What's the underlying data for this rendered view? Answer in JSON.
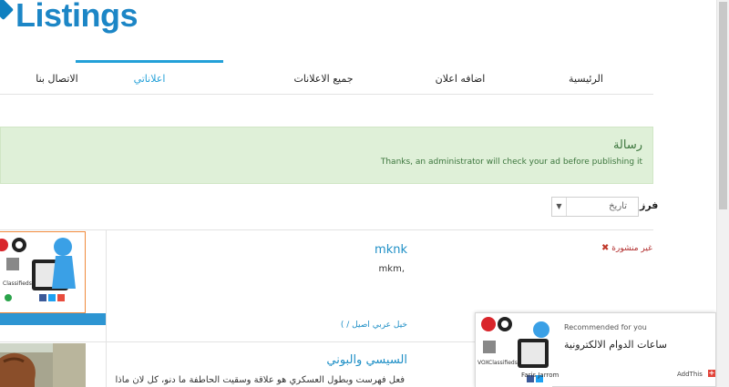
{
  "logo": {
    "text": "Listings"
  },
  "nav": {
    "items": [
      {
        "label": "الرئيسية"
      },
      {
        "label": "اضافه اعلان"
      },
      {
        "label": "جميع الاعلانات"
      },
      {
        "label": "اعلاناتي"
      },
      {
        "label": "الاتصال بنا"
      }
    ],
    "active_index": 3
  },
  "alert": {
    "title": "رسالة",
    "text": "Thanks, an administrator will check your ad before publishing it"
  },
  "sort": {
    "label": "فرز",
    "value": "تاريخ"
  },
  "listings": [
    {
      "title": "mknk",
      "description": "mkm,",
      "category": "( / خيل عربي اصيل",
      "status": "غير منشورة"
    },
    {
      "title": "السيسي والبوني",
      "description": "فعل فهرست وبطول العسكري هو علاقة وسقيت الحاطفة ما دنو، كل لان ماذا"
    }
  ],
  "ad": {
    "recommended": "Recommended for you",
    "title": "ساعات الدوام الالكترونية",
    "addthis": "AddThis",
    "caption": "Faris Jarrom"
  },
  "colors": {
    "brand": "#1c86c6",
    "accent": "#23a0d8",
    "alert_bg": "#dff0d8",
    "alert_text": "#3c763d",
    "status_red": "#b02a2a"
  }
}
